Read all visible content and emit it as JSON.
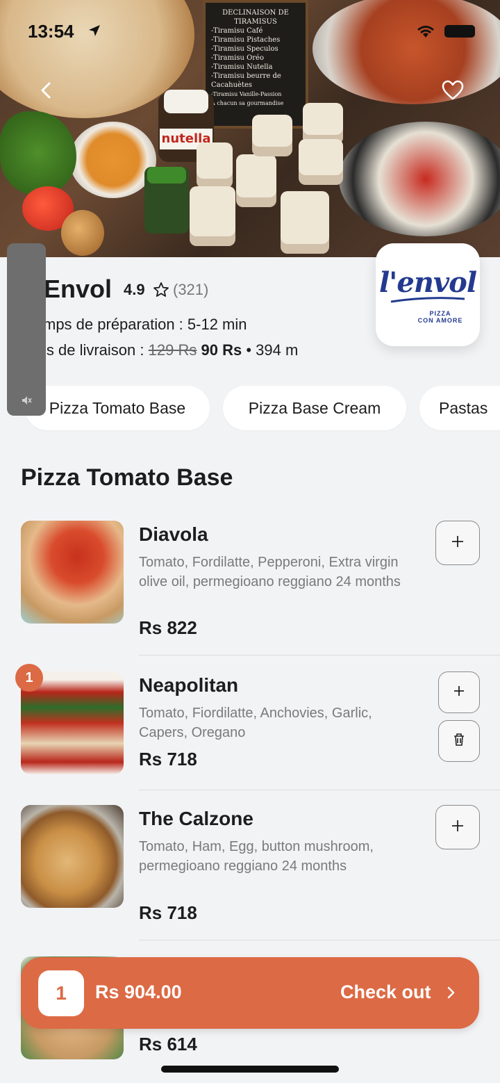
{
  "status_bar": {
    "time": "13:54"
  },
  "hero": {
    "chalkboard_lines": [
      "DECLINAISON DE",
      "TIRAMISUS",
      "-Tiramisu Café",
      "-Tiramisu Pistaches",
      "-Tiramisu Speculos",
      "-Tiramisu Oréo",
      "-Tiramisu Nutella",
      "-Tiramisu beurre de",
      "  Cacahuètes",
      "-Tiramisu Vanille-Passion",
      "À chacun sa gourmandise"
    ],
    "jar_label": "nutella"
  },
  "restaurant": {
    "name": "Envol",
    "rating": "4.9",
    "rating_count": "(321)",
    "prep_time": "mps de préparation : 5-12 min",
    "delivery_label": "is de livraison :",
    "delivery_old": "129 Rs",
    "delivery_new": "90 Rs",
    "distance": "• 394 m",
    "logo": {
      "script": "l'envol",
      "sub1": "PIZZA",
      "sub2": "CON AMORE"
    }
  },
  "categories": [
    {
      "label": "Pizza Tomato Base"
    },
    {
      "label": "Pizza Base Cream"
    },
    {
      "label": "Pastas"
    }
  ],
  "section_title": "Pizza Tomato Base",
  "items": [
    {
      "name": "Diavola",
      "desc": "Tomato, Fordilatte, Pepperoni, Extra virgin olive oil, permegioano reggiano 24 months",
      "price": "Rs 822"
    },
    {
      "name": "Neapolitan",
      "desc": "Tomato, Fiordilatte, Anchovies, Garlic, Capers, Oregano",
      "price": "Rs 718",
      "qty": "1"
    },
    {
      "name": "The Calzone",
      "desc": "Tomato, Ham, Egg, button mushroom, permegioano reggiano 24 months",
      "price": "Rs 718"
    },
    {
      "name": "",
      "desc": "",
      "price": "Rs 614"
    }
  ],
  "checkout": {
    "count": "1",
    "total": "Rs 904.00",
    "label": "Check out"
  },
  "colors": {
    "accent": "#dc6a45",
    "brand_blue": "#233a8f",
    "background": "#f2f3f5"
  },
  "icons": [
    "location-arrow-icon",
    "wifi-icon",
    "battery-icon",
    "back-chevron-icon",
    "heart-icon",
    "star-icon",
    "mute-icon",
    "plus-icon",
    "trash-icon",
    "chevron-right-icon"
  ]
}
